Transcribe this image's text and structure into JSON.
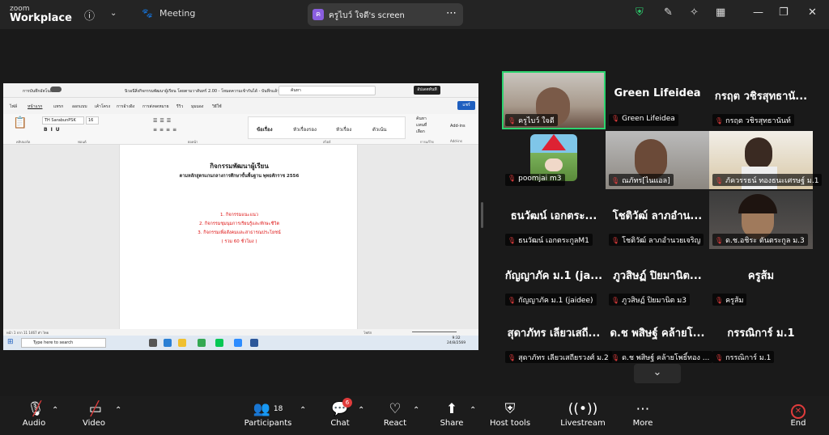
{
  "titlebar": {
    "brand_line1": "zoom",
    "brand_line2": "Workplace",
    "meeting_label": "Meeting",
    "share_tab_label": "ครูไบว์ ใจดี's screen"
  },
  "shared_window": {
    "doc_title": "นิวอนีสิ่งกิจกรรมพัฒนาผู้เรียน โดยตามวาสันทร์ 2.00 - โหมดความเข้ากันได้ - บันทึกแล้ว",
    "search_placeholder": "ค้นหา",
    "update_button": "อัปเดตทันที",
    "autosave": "การบันทึกอัตโนมัติ",
    "menu_tabs": [
      "ไฟล์",
      "หน้าแรก",
      "แทรก",
      "ออกแบบ",
      "เค้าโครง",
      "การอ้างอิง",
      "การส่งจดหมาย",
      "รีวิว",
      "มุมมอง",
      "วิธีใช้"
    ],
    "share_button": "แชร์",
    "font_name": "TH SarabunPSK",
    "font_size": "16",
    "styles": [
      "ข้อเรื่อง",
      "หัวเรื่องรอง",
      "หัวเรื่อง",
      "ตัวเน้น"
    ],
    "ribbon_labels": [
      "คลิปบอร์ด",
      "ฟอนต์",
      "ย่อหน้า",
      "สไตล์",
      "การแก้ไข",
      "Add-ins"
    ],
    "edit_items": [
      "ค้นหา",
      "แทนที่",
      "เลือก"
    ],
    "addins": "Add-ins",
    "doc_heading": "กิจกรรมพัฒนาผู้เรียน",
    "doc_subheading": "ตามหลักสูตรแกนกลางการศึกษาขั้นพื้นฐาน พุทธศักราช 2556",
    "doc_items": [
      "1. กิจกรรมแนะแนว",
      "2. กิจกรรมชุมนุมการเรียนรู้และทักษะชีวิต",
      "3. กิจกรรมเพื่อสังคมและสาธารณประโยชน์",
      "( รวม 60 ชั่วโมง )"
    ],
    "status_left": "หน้า 1 จาก 11    1467 คำ    ไทย",
    "status_right": "โฟกัส",
    "taskbar_search": "Type here to search",
    "clock_time": "9:32",
    "clock_date": "24/8/2569"
  },
  "participants": [
    {
      "name": "ครูไบว์ ใจดี",
      "muted": true,
      "type": "video",
      "active": true
    },
    {
      "name": "Green Lifeidea",
      "display_name": "Green Lifeidea",
      "muted": true,
      "type": "name"
    },
    {
      "name": "กรฤต วชิรสุทธานันท์",
      "display_name": "กรฤต วชิรสุทธานั...",
      "muted": true,
      "type": "name"
    },
    {
      "name": "poomjai m3",
      "muted": true,
      "type": "avatar"
    },
    {
      "name": "ณภัทร[ไนแอล]",
      "muted": true,
      "type": "video"
    },
    {
      "name": "ภัควรรธน์ ทองธนะเศรษฐ์ ม.1",
      "muted": true,
      "type": "video"
    },
    {
      "name": "ธนวัฒน์ เอกตระกูลM1",
      "display_name": "ธนวัฒน์ เอกตระ...",
      "muted": true,
      "type": "name"
    },
    {
      "name": "โชติวัฒ์ ลาภอำนวยเจริญ",
      "display_name": "โชติวัฒ์ ลาภอำน...",
      "muted": true,
      "type": "name"
    },
    {
      "name": "ด.ช.อชิระ ตันตระกูล ม.3",
      "muted": true,
      "type": "video"
    },
    {
      "name": "กัญญาภัค ม.1 (jaidee)",
      "display_name": "กัญญาภัค ม.1 (ja...",
      "muted": true,
      "type": "name"
    },
    {
      "name": "ภูวสิษฏ์ ปิยมานิต ม3",
      "display_name": "ภูวสิษฏ์ ปิยมานิต...",
      "muted": true,
      "type": "name"
    },
    {
      "name": "ครูส้ม",
      "display_name": "ครูส้ม",
      "muted": true,
      "type": "name"
    },
    {
      "name": "สุดาภัทร เลียวเสถียรวงศ์ ม.2",
      "display_name": "สุดาภัทร เลียวเสถี...",
      "muted": true,
      "type": "name"
    },
    {
      "name": "ด.ช พสิษฐ์ คล้ายโพธิ์ทอง ...",
      "display_name": "ด.ช พสิษฐ์ คล้ายโ...",
      "muted": true,
      "type": "name"
    },
    {
      "name": "กรรณิการ์ ม.1",
      "display_name": "กรรณิการ์ ม.1",
      "muted": true,
      "type": "name"
    }
  ],
  "toolbar": {
    "audio": "Audio",
    "video": "Video",
    "participants": "Participants",
    "participants_count": "18",
    "chat": "Chat",
    "chat_badge": "6",
    "react": "React",
    "share": "Share",
    "host_tools": "Host tools",
    "livestream": "Livestream",
    "more": "More",
    "end": "End"
  },
  "colors": {
    "active_speaker": "#2dd36f",
    "muted_red": "#e03c3c",
    "toolbar_bg": "#1c1c1c"
  }
}
